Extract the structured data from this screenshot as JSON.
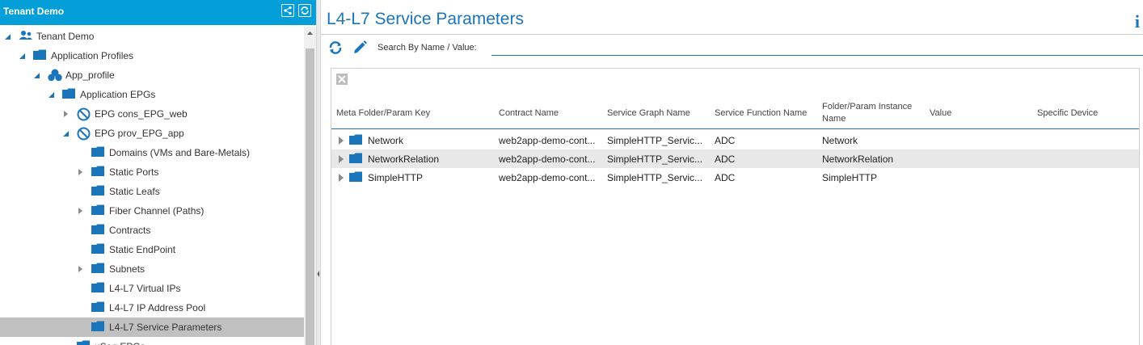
{
  "left_panel": {
    "title": "Tenant Demo",
    "tree": [
      {
        "label": "Tenant Demo",
        "depth": 0,
        "caret": "expanded",
        "icon": "tenant-icon"
      },
      {
        "label": "Application Profiles",
        "depth": 1,
        "caret": "expanded",
        "icon": "folder-icon"
      },
      {
        "label": "App_profile",
        "depth": 2,
        "caret": "expanded",
        "icon": "app-profile-icon"
      },
      {
        "label": "Application EPGs",
        "depth": 3,
        "caret": "expanded",
        "icon": "folder-icon"
      },
      {
        "label": "EPG cons_EPG_web",
        "depth": 4,
        "caret": "collapsed",
        "icon": "epg-icon"
      },
      {
        "label": "EPG prov_EPG_app",
        "depth": 4,
        "caret": "expanded",
        "icon": "epg-icon"
      },
      {
        "label": "Domains (VMs and Bare-Metals)",
        "depth": 5,
        "caret": "none",
        "icon": "folder-icon"
      },
      {
        "label": "Static Ports",
        "depth": 5,
        "caret": "collapsed",
        "icon": "folder-icon"
      },
      {
        "label": "Static Leafs",
        "depth": 5,
        "caret": "none",
        "icon": "folder-icon"
      },
      {
        "label": "Fiber Channel (Paths)",
        "depth": 5,
        "caret": "collapsed",
        "icon": "folder-icon"
      },
      {
        "label": "Contracts",
        "depth": 5,
        "caret": "none",
        "icon": "folder-icon"
      },
      {
        "label": "Static EndPoint",
        "depth": 5,
        "caret": "none",
        "icon": "folder-icon"
      },
      {
        "label": "Subnets",
        "depth": 5,
        "caret": "collapsed",
        "icon": "folder-icon"
      },
      {
        "label": "L4-L7 Virtual IPs",
        "depth": 5,
        "caret": "none",
        "icon": "folder-icon"
      },
      {
        "label": "L4-L7 IP Address Pool",
        "depth": 5,
        "caret": "none",
        "icon": "folder-icon"
      },
      {
        "label": "L4-L7 Service Parameters",
        "depth": 5,
        "caret": "none",
        "icon": "folder-icon",
        "selected": true
      },
      {
        "label": "uSeg EPGs",
        "depth": 4,
        "caret": "none",
        "icon": "folder-icon"
      }
    ]
  },
  "main": {
    "title": "L4-L7 Service Parameters",
    "search_label": "Search By Name / Value:",
    "search_value": "",
    "columns": [
      "Meta Folder/Param Key",
      "Contract Name",
      "Service Graph Name",
      "Service Function Name",
      "Folder/Param Instance Name",
      "Value",
      "Specific Device"
    ],
    "rows": [
      {
        "key": "Network",
        "contract": "web2app-demo-cont...",
        "graph": "SimpleHTTP_Servic...",
        "function": "ADC",
        "instance": "Network",
        "value": "",
        "device": ""
      },
      {
        "key": "NetworkRelation",
        "contract": "web2app-demo-cont...",
        "graph": "SimpleHTTP_Servic...",
        "function": "ADC",
        "instance": "NetworkRelation",
        "value": "",
        "device": ""
      },
      {
        "key": "SimpleHTTP",
        "contract": "web2app-demo-cont...",
        "graph": "SimpleHTTP_Servic...",
        "function": "ADC",
        "instance": "SimpleHTTP",
        "value": "",
        "device": ""
      }
    ]
  },
  "colors": {
    "header_blue": "#049fd9",
    "accent_blue": "#1b75bb",
    "folder_blue": "#1b75bb",
    "selected_row": "#c0c0c0"
  }
}
